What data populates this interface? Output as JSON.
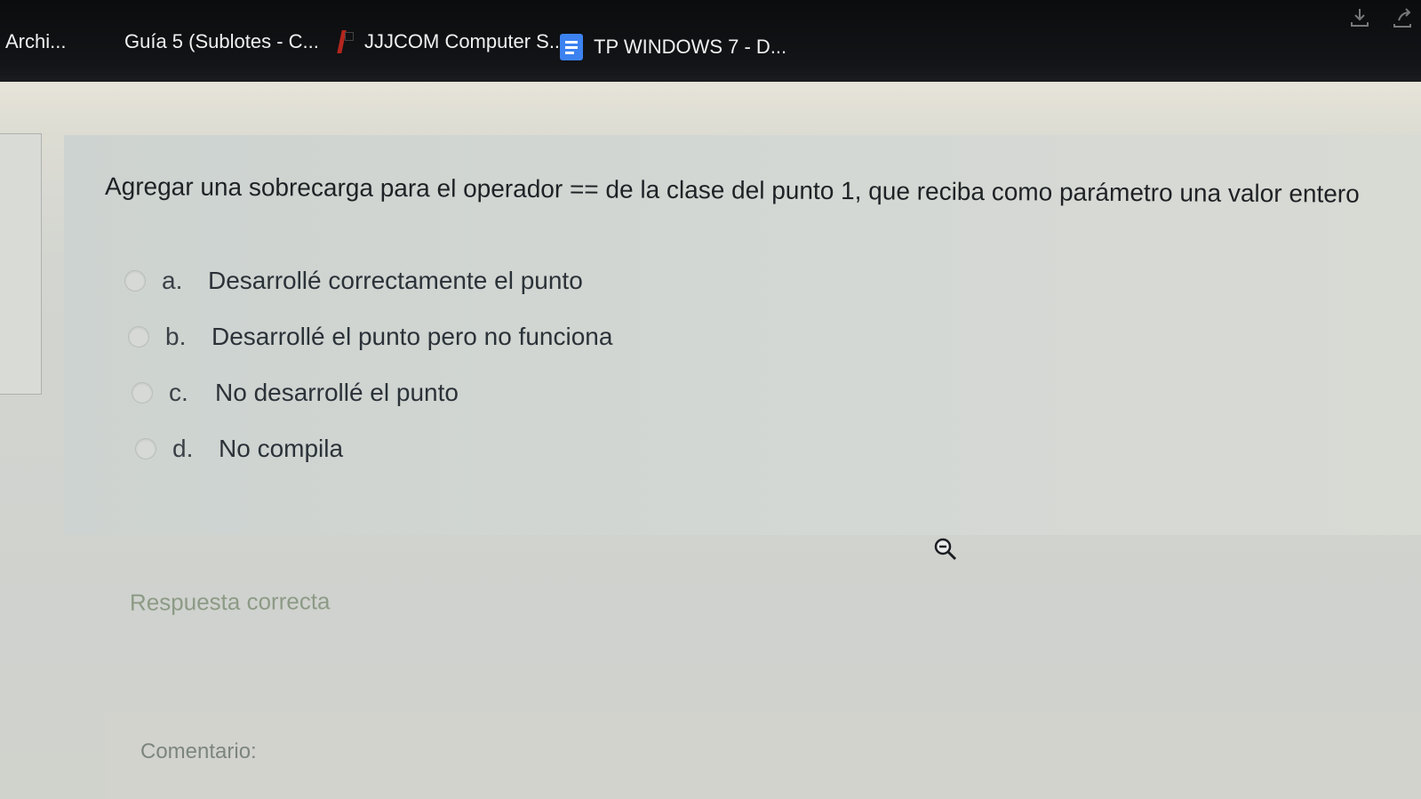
{
  "bookmarks": [
    {
      "label": "Archi...",
      "icon": ""
    },
    {
      "label": "Guía 5 (Sublotes - C...",
      "icon": ""
    },
    {
      "label": "JJJCOM Computer S...",
      "icon": "pdf-icon"
    },
    {
      "label": "TP WINDOWS 7 - D...",
      "icon": "google-docs-icon"
    }
  ],
  "top_icons": [
    "download-icon",
    "share-icon"
  ],
  "quiz": {
    "question": "Agregar una sobrecarga para el operador == de la clase del punto 1, que reciba como parámetro una valor entero",
    "options": [
      {
        "letter": "a.",
        "text": "Desarrollé correctamente el punto"
      },
      {
        "letter": "b.",
        "text": "Desarrollé el punto pero no funciona"
      },
      {
        "letter": "c.",
        "text": "No desarrollé el punto"
      },
      {
        "letter": "d.",
        "text": "No compila"
      }
    ],
    "feedback": "Respuesta correcta",
    "comment_label": "Comentario:"
  },
  "cursor_icon": "zoom-out-icon",
  "colors": {
    "toolbar_bg": "#0f1113",
    "page_bg": "#d0d3cf",
    "question_text": "#1e2225",
    "feedback_text": "#8d9a86",
    "docs_blue": "#3c82f0"
  }
}
